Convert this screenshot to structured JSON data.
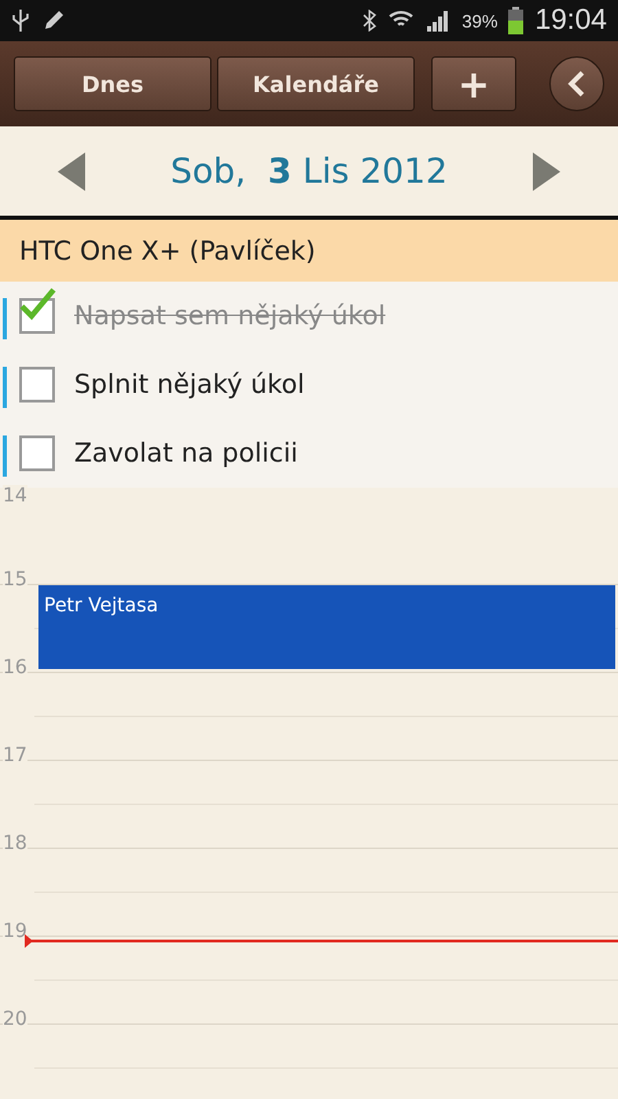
{
  "status_bar": {
    "battery": "39%",
    "time": "19:04"
  },
  "toolbar": {
    "buttons": [
      {
        "label": "Dnes",
        "kind": "text"
      },
      {
        "label": "Kalendáře",
        "kind": "text"
      },
      {
        "label": "+",
        "kind": "add"
      }
    ]
  },
  "date_nav": {
    "weekday": "Sob,",
    "day": "3",
    "month_year": "Lis 2012"
  },
  "task_group": {
    "title": "HTC One X+ (Pavlíček)",
    "tasks": [
      {
        "title": "Napsat sem nějaký úkol",
        "checked": true
      },
      {
        "title": "Splnit nějaký úkol",
        "checked": false
      },
      {
        "title": "Zavolat na policii",
        "checked": false
      }
    ]
  },
  "hours": [
    {
      "label": "14",
      "now": false
    },
    {
      "label": "15",
      "now": false,
      "events": [
        {
          "title": "Petr Vejtasa",
          "color": "#1654b8"
        }
      ]
    },
    {
      "label": "16",
      "now": false
    },
    {
      "label": "17",
      "now": false
    },
    {
      "label": "18",
      "now": false
    },
    {
      "label": "19",
      "now": true
    },
    {
      "label": "20",
      "now": false
    }
  ]
}
